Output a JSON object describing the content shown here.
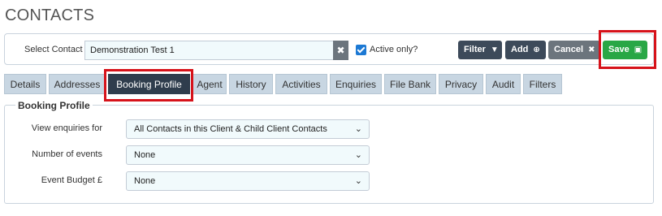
{
  "page": {
    "title": "CONTACTS"
  },
  "toolbar": {
    "select_label": "Select Contact",
    "contact_value": "Demonstration Test 1",
    "clear_symbol": "✖",
    "active_label": "Active only?",
    "active_checked": true,
    "filter_label": "Filter",
    "add_label": "Add",
    "cancel_label": "Cancel",
    "save_label": "Save"
  },
  "tabs": [
    {
      "label": "Details"
    },
    {
      "label": "Addresses"
    },
    {
      "label": "Booking Profile",
      "active": true
    },
    {
      "label": "Agent"
    },
    {
      "label": "History"
    },
    {
      "label": "Activities"
    },
    {
      "label": "Enquiries"
    },
    {
      "label": "File Bank"
    },
    {
      "label": "Privacy"
    },
    {
      "label": "Audit"
    },
    {
      "label": "Filters"
    }
  ],
  "booking_profile": {
    "legend": "Booking Profile",
    "fields": [
      {
        "label": "View enquiries for",
        "value": "All Contacts in this Client & Child Client Contacts"
      },
      {
        "label": "Number of events",
        "value": "None"
      },
      {
        "label": "Event Budget £",
        "value": "None"
      }
    ]
  },
  "colors": {
    "highlight": "#d6121a",
    "save": "#28a745",
    "dark_button": "#3d4a5a",
    "cancel": "#6c757d",
    "tab_bg": "#c8d6e2",
    "tab_active": "#2f3d4d"
  }
}
